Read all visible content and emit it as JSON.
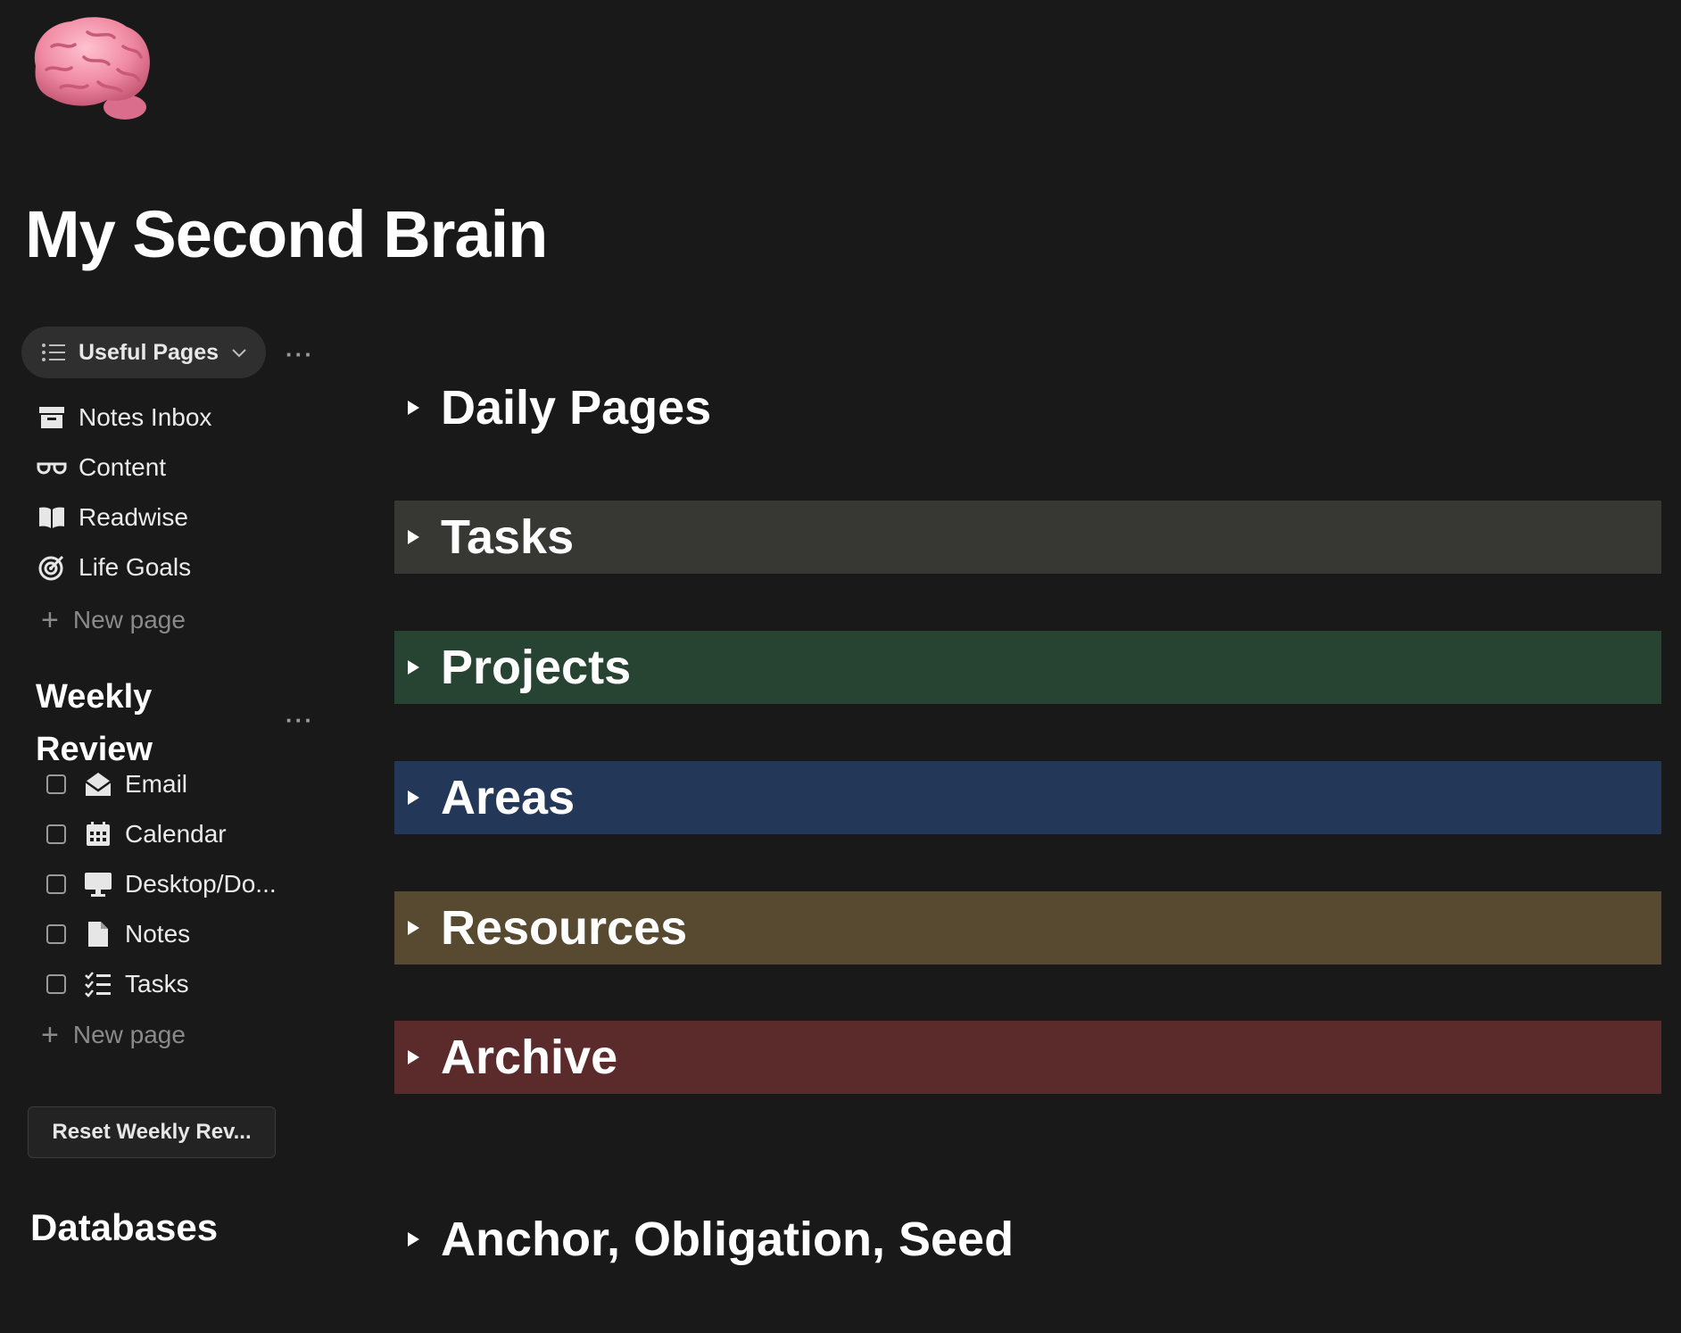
{
  "page": {
    "icon": "brain-emoji",
    "title": "My Second Brain"
  },
  "sidebar": {
    "view_selector": {
      "label": "Useful Pages",
      "icon": "list-icon"
    },
    "items": [
      {
        "label": "Notes Inbox",
        "icon": "archive-box-icon"
      },
      {
        "label": "Content",
        "icon": "glasses-icon"
      },
      {
        "label": "Readwise",
        "icon": "book-icon"
      },
      {
        "label": "Life Goals",
        "icon": "target-icon"
      }
    ],
    "new_page_label": "New page",
    "weekly_review": {
      "heading": "Weekly Review",
      "items": [
        {
          "label": "Email",
          "icon": "envelope-icon",
          "checked": false
        },
        {
          "label": "Calendar",
          "icon": "calendar-icon",
          "checked": false
        },
        {
          "label": "Desktop/Do...",
          "icon": "desktop-icon",
          "checked": false
        },
        {
          "label": "Notes",
          "icon": "document-icon",
          "checked": false
        },
        {
          "label": "Tasks",
          "icon": "checklist-icon",
          "checked": false
        }
      ],
      "new_page_label": "New page",
      "reset_button": "Reset Weekly Rev..."
    },
    "databases_heading": "Databases"
  },
  "toggles": [
    {
      "label": "Daily Pages",
      "bg": "#191919"
    },
    {
      "label": "Tasks",
      "bg": "#373733"
    },
    {
      "label": "Projects",
      "bg": "#274332"
    },
    {
      "label": "Areas",
      "bg": "#233858"
    },
    {
      "label": "Resources",
      "bg": "#574a30"
    },
    {
      "label": "Archive",
      "bg": "#5b2a2b"
    },
    {
      "label": "Anchor, Obligation, Seed",
      "bg": "#191919"
    }
  ],
  "colors": {
    "background": "#191919",
    "text": "#ebebeb",
    "muted": "#8a8a8a"
  }
}
